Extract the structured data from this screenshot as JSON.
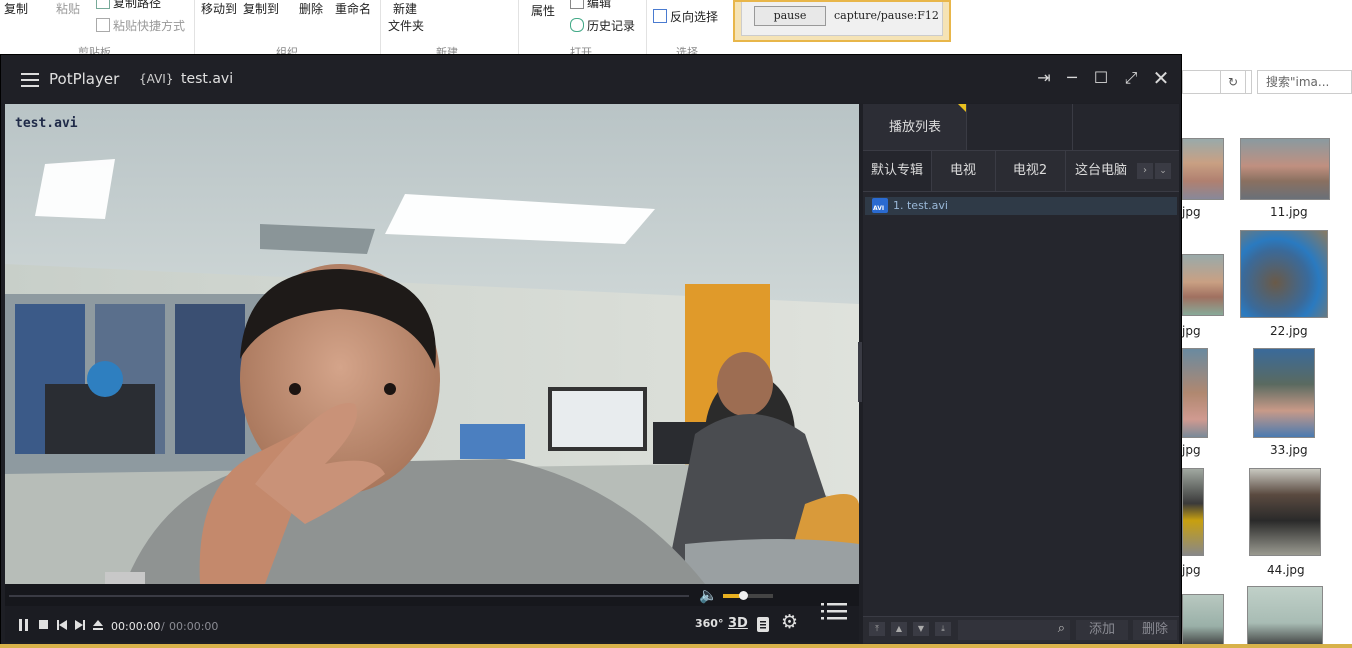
{
  "ribbon": {
    "copy": "复制",
    "paste": "粘贴",
    "copy_path": "复制路径",
    "paste_shortcut": "粘贴快捷方式",
    "move_to": "移动到",
    "copy_to": "复制到",
    "delete": "删除",
    "rename": "重命名",
    "new_folder_line1": "新建",
    "new_folder_line2": "文件夹",
    "properties": "属性",
    "edit": "编辑",
    "history": "历史记录",
    "invert_select": "反向选择",
    "group_clipboard": "剪贴板",
    "group_organize": "组织",
    "group_new": "新建",
    "group_open": "打开",
    "group_select": "选择"
  },
  "capture_popup": {
    "button": "pause",
    "text": "capture/pause:F12"
  },
  "explorer": {
    "search_placeholder": "搜索\"ima...",
    "files": [
      "jpg",
      "11.jpg",
      "jpg",
      "22.jpg",
      "jpg",
      "33.jpg",
      "jpg",
      "44.jpg"
    ]
  },
  "player": {
    "app_name": "PotPlayer",
    "format": "{AVI}",
    "file_name": "test.avi",
    "osd_text": "test.avi",
    "time_current": "00:00:00",
    "time_sep": "/",
    "time_total": "00:00:00",
    "btn_360": "360°",
    "btn_3d": "3D",
    "volume_level": 0.4
  },
  "playlist": {
    "title": "播放列表",
    "tabs": [
      "默认专辑",
      "电视",
      "电视2",
      "这台电脑"
    ],
    "items": [
      {
        "label": "1. test.avi",
        "icon_text": "AVI"
      }
    ],
    "add": "添加",
    "remove": "删除"
  }
}
